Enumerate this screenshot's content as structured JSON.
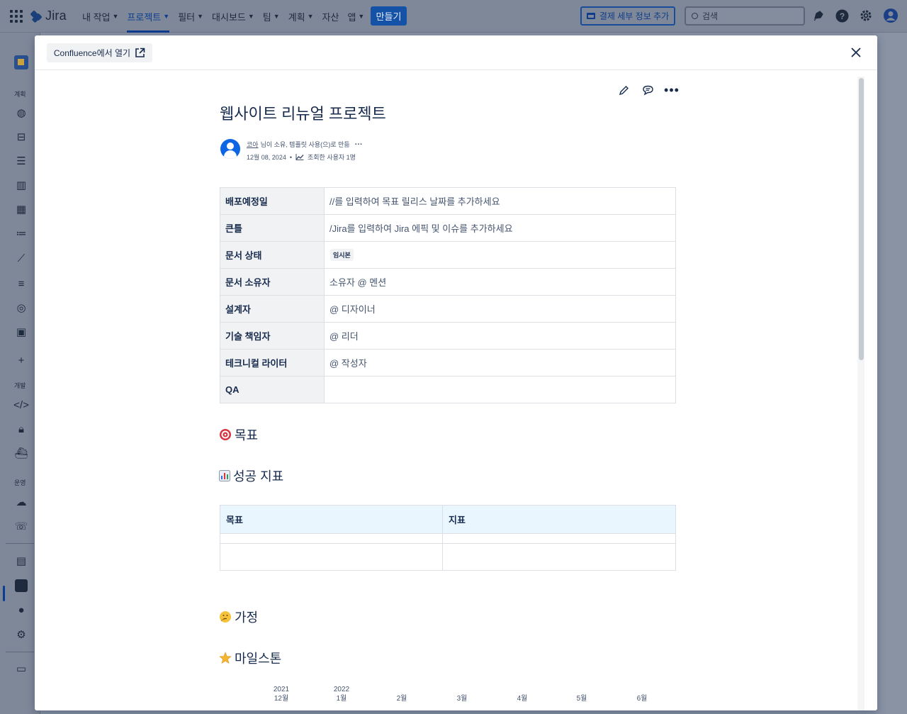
{
  "topnav": {
    "app_name": "Jira",
    "items": [
      {
        "label": "내 작업",
        "active": false,
        "dropdown": true
      },
      {
        "label": "프로젝트",
        "active": true,
        "dropdown": true
      },
      {
        "label": "필터",
        "active": false,
        "dropdown": true
      },
      {
        "label": "대시보드",
        "active": false,
        "dropdown": true
      },
      {
        "label": "팀",
        "active": false,
        "dropdown": true
      },
      {
        "label": "계획",
        "active": false,
        "dropdown": true
      },
      {
        "label": "자산",
        "active": false,
        "dropdown": false
      },
      {
        "label": "앱",
        "active": false,
        "dropdown": true
      }
    ],
    "create_label": "만들기",
    "payment_label": "결제 세부 정보 추가",
    "search_placeholder": "검색",
    "icons": [
      "app-switcher-icon",
      "notifications-icon",
      "help-icon",
      "settings-icon",
      "profile-icon"
    ]
  },
  "sidebar": {
    "section_plan": "계획",
    "section_dev": "개발",
    "section_ops": "운영"
  },
  "modal": {
    "open_in_confluence": "Confluence에서 열기",
    "page": {
      "title": "웹사이트 리뉴얼 프로젝트",
      "author": "코아",
      "byline_suffix": "님이 소유, 템플릿 사용(으)로 만듦",
      "date": "12월 08, 2024",
      "views": "조회한 사용자 1명"
    },
    "properties": [
      {
        "key": "배포예정일",
        "value": "//를 입력하여 목표 릴리스 날짜를 추가하세요"
      },
      {
        "key": "큰틀",
        "value": "/Jira를 입력하여 Jira 에픽 및 이슈를 추가하세요"
      },
      {
        "key": "문서 상태",
        "value": "",
        "badge": "임시본"
      },
      {
        "key": "문서 소유자",
        "value": "소유자 @ 멘션"
      },
      {
        "key": "설계자",
        "value": "@ 디자이너"
      },
      {
        "key": "기술 책임자",
        "value": "@ 리더"
      },
      {
        "key": "테크니컬 라이터",
        "value": "@ 작성자"
      },
      {
        "key": "QA",
        "value": ""
      }
    ],
    "headings": {
      "goals": "목표",
      "metrics": "성공 지표",
      "assumptions": "가정",
      "milestones": "마일스톤"
    },
    "metrics_table": {
      "col_goal": "목표",
      "col_metric": "지표"
    },
    "timeline": [
      {
        "year": "2021",
        "month": "12월"
      },
      {
        "year": "2022",
        "month": "1월"
      },
      {
        "year": "",
        "month": "2월"
      },
      {
        "year": "",
        "month": "3월"
      },
      {
        "year": "",
        "month": "4월"
      },
      {
        "year": "",
        "month": "5월"
      },
      {
        "year": "",
        "month": "6월"
      }
    ]
  }
}
